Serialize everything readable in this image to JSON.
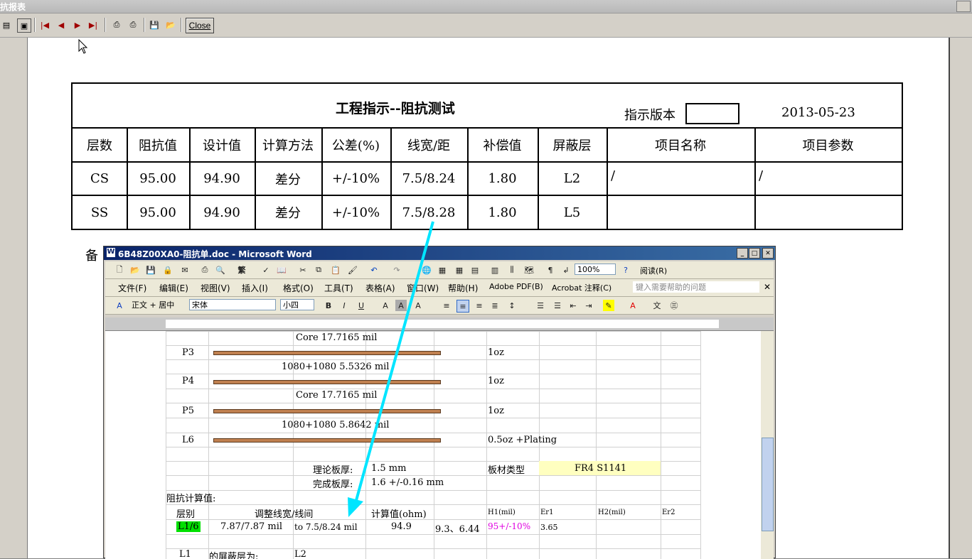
{
  "window": {
    "title": "抗报表"
  },
  "toolbar": {
    "close_label": "Close"
  },
  "report": {
    "title": "工程指示--阻抗测试",
    "version_label": "指示版本",
    "date": "2013-05-23",
    "headers": [
      "层数",
      "阻抗值",
      "设计值",
      "计算方法",
      "公差(%)",
      "线宽/距",
      "补偿值",
      "屏蔽层",
      "项目名称",
      "项目参数"
    ],
    "rows": [
      [
        "CS",
        "95.00",
        "94.90",
        "差分",
        "+/-10%",
        "7.5/8.24",
        "1.80",
        "L2",
        "/",
        "/"
      ],
      [
        "SS",
        "95.00",
        "94.90",
        "差分",
        "+/-10%",
        "7.5/8.28",
        "1.80",
        "L5",
        "",
        ""
      ]
    ],
    "note_label": "备"
  },
  "word": {
    "title": "6B48Z00XA0-阻抗单.doc - Microsoft Word",
    "zoom": "100%",
    "read_label": "阅读(R)",
    "menus": [
      "文件(F)",
      "编辑(E)",
      "视图(V)",
      "插入(I)",
      "格式(O)",
      "工具(T)",
      "表格(A)",
      "窗口(W)",
      "帮助(H)",
      "Adobe PDF(B)",
      "Acrobat 注释(C)"
    ],
    "help_placeholder": "键入需要帮助的问题",
    "style": "正文 + 居中",
    "font": "宋体",
    "size": "小四",
    "traditional": "繁",
    "doc": {
      "core1": "Core   17.7165 mil",
      "p3": "P3",
      "p3_oz": "1oz",
      "pp1": "1080+1080    5.5326 mil",
      "p4": "P4",
      "p4_oz": "1oz",
      "core2": "Core   17.7165 mil",
      "p5": "P5",
      "p5_oz": "1oz",
      "pp2": "1080+1080    5.8642 mil",
      "l6": "L6",
      "l6_oz": "0.5oz +Plating",
      "thick_label": "理论板厚:",
      "thick_val": "1.5 mm",
      "mat_label": "板材类型",
      "mat_val": "FR4 S1141",
      "fin_label": "完成板厚:",
      "fin_val": "1.6 +/-0.16 mm",
      "calc_title": "阻抗计算值:",
      "h_layer": "层别",
      "h_adjust": "调整线宽/线间",
      "h_calc": "计算值(ohm)",
      "h_h1": "H1(mil)",
      "h_er1": "Er1",
      "h_h2": "H2(mil)",
      "h_er2": "Er2",
      "r_layer": "L1/6",
      "r_from": "7.87/7.87 mil",
      "r_to": "to  7.5/8.24 mil",
      "r_calc": "94.9",
      "r_vals": "9.3、6.44",
      "r_tol": "95+/-10%",
      "r_er1": "3.65",
      "last_layer": "L1",
      "last_text": "的屏蔽层为:",
      "last_val": "L2"
    }
  },
  "colors": {
    "highlight_green": "#00e000",
    "highlight_yellow": "#ffffc0",
    "arrow": "#00e5ff",
    "magenta": "#e000e0"
  }
}
